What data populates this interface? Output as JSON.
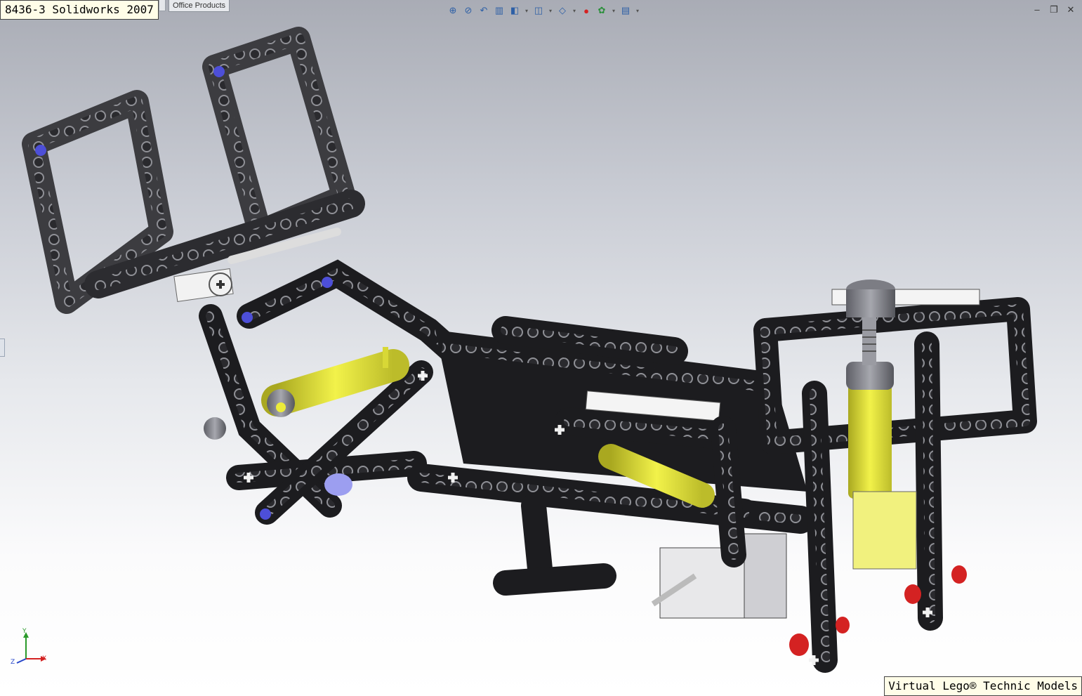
{
  "document": {
    "title": "8436-3 Solidworks 2007"
  },
  "tabs": {
    "office_products": "Office Products"
  },
  "toolbar": {
    "icons": [
      "zoom-to-fit-icon",
      "zoom-area-icon",
      "previous-view-icon",
      "section-view-icon",
      "view-orientation-icon",
      "display-style-icon",
      "hide-show-icon",
      "edit-appearance-icon",
      "apply-scene-icon",
      "view-settings-icon"
    ]
  },
  "window_controls": {
    "minimize": "‒",
    "restore": "❐",
    "close": "✕"
  },
  "triad": {
    "y": "Y",
    "x": "X",
    "z": "Z"
  },
  "footer": {
    "caption": "Virtual Lego® Technic Models"
  },
  "colors": {
    "beam_black": "#1c1c1f",
    "beam_grey": "#56575c",
    "part_yellow": "#ecec3a",
    "pin_blue": "#4d4fd8",
    "pin_red": "#d42222",
    "part_white": "#f2f2f2"
  }
}
